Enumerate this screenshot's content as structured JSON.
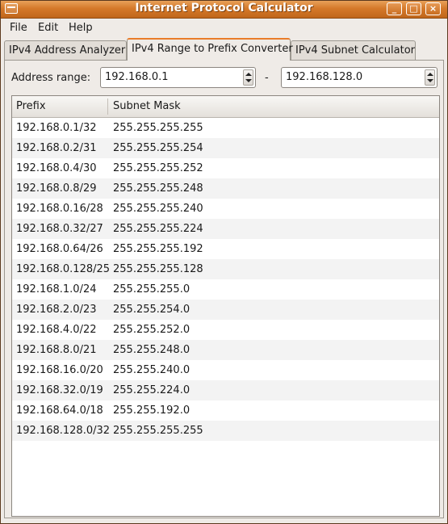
{
  "window": {
    "title": "Internet Protocol Calculator"
  },
  "menu": {
    "file": "File",
    "edit": "Edit",
    "help": "Help"
  },
  "tabs": [
    {
      "label": "IPv4 Address Analyzer",
      "active": false
    },
    {
      "label": "IPv4 Range to Prefix Converter",
      "active": true
    },
    {
      "label": "IPv4 Subnet Calculator",
      "active": false
    }
  ],
  "address_range": {
    "label": "Address range:",
    "start": "192.168.0.1",
    "separator": "-",
    "end": "192.168.128.0"
  },
  "table": {
    "columns": [
      "Prefix",
      "Subnet Mask"
    ],
    "rows": [
      [
        "192.168.0.1/32",
        "255.255.255.255"
      ],
      [
        "192.168.0.2/31",
        "255.255.255.254"
      ],
      [
        "192.168.0.4/30",
        "255.255.255.252"
      ],
      [
        "192.168.0.8/29",
        "255.255.255.248"
      ],
      [
        "192.168.0.16/28",
        "255.255.255.240"
      ],
      [
        "192.168.0.32/27",
        "255.255.255.224"
      ],
      [
        "192.168.0.64/26",
        "255.255.255.192"
      ],
      [
        "192.168.0.128/25",
        "255.255.255.128"
      ],
      [
        "192.168.1.0/24",
        "255.255.255.0"
      ],
      [
        "192.168.2.0/23",
        "255.255.254.0"
      ],
      [
        "192.168.4.0/22",
        "255.255.252.0"
      ],
      [
        "192.168.8.0/21",
        "255.255.248.0"
      ],
      [
        "192.168.16.0/20",
        "255.255.240.0"
      ],
      [
        "192.168.32.0/19",
        "255.255.224.0"
      ],
      [
        "192.168.64.0/18",
        "255.255.192.0"
      ],
      [
        "192.168.128.0/32",
        "255.255.255.255"
      ]
    ]
  },
  "colors": {
    "titlebar": "#d5792a",
    "active_tab_accent": "#e97d2a",
    "row_alt": "#f3f3f3"
  }
}
